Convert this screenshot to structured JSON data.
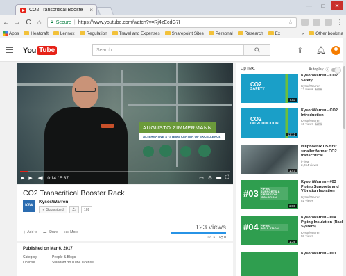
{
  "browser": {
    "tab_title": "CO2 Transcritical Booste",
    "tab_close": "×",
    "address_secure": "Secure",
    "address_url": "https://www.youtube.com/watch?v=Rj4zEcdG7I",
    "window_min": "—",
    "window_max": "□",
    "window_close": "✕"
  },
  "bookmarks": [
    {
      "label": "Apps",
      "type": "apps"
    },
    {
      "label": "Heatcraft",
      "type": "folder"
    },
    {
      "label": "Lennox",
      "type": "folder"
    },
    {
      "label": "Regulation",
      "type": "folder"
    },
    {
      "label": "Travel and Expenses",
      "type": "folder"
    },
    {
      "label": "Sharepoint Sites",
      "type": "folder"
    },
    {
      "label": "Personal",
      "type": "folder"
    },
    {
      "label": "Research",
      "type": "folder"
    },
    {
      "label": "Ex",
      "type": "folder"
    }
  ],
  "bookmarks_more": "»",
  "bookmarks_other": "Other bookma",
  "youtube": {
    "logo_you": "You",
    "logo_tube": "Tube",
    "search_placeholder": "Search"
  },
  "player": {
    "overlay_name": "AUGUSTO ZIMMERMANN",
    "overlay_sub": "ALTERNATIVE SYSTEMS CENTER OF EXCELLENCE",
    "time": "0:14 / 5:37",
    "progress_fraction": 0.04
  },
  "video": {
    "title": "CO2 Transcritical Booster Rack",
    "channel": "Kysor/Warren",
    "channel_logo": "K/W",
    "subscribe": "✓ Subscribed",
    "sub_count": "109",
    "views": "123 views",
    "add_to": "Add to",
    "share": "Share",
    "more": "More",
    "likes": "3",
    "dislikes": "0"
  },
  "description": {
    "published": "Published on Mar 6, 2017",
    "category_key": "Category",
    "category_value": "People & Blogs",
    "license_key": "License",
    "license_value": "Standard YouTube License"
  },
  "sidebar": {
    "up_next": "Up next",
    "autoplay": "Autoplay",
    "items": [
      {
        "title": "Kysor/Warren - CO2 Safety",
        "channel": "Kysor/Warren",
        "views": "13 views",
        "badge": "NEW",
        "thumb_big": "CO2",
        "thumb_small": "SAFETY",
        "duration": "7:53",
        "color": "#1a9fc8",
        "kind": "teal"
      },
      {
        "title": "Kysor/Warren - CO2 Introduction",
        "channel": "Kysor/Warren",
        "views": "10 views",
        "badge": "NEW",
        "thumb_big": "CO2",
        "thumb_small": "INTRODUCTION",
        "duration": "12:12",
        "color": "#1a9fc8",
        "kind": "teal"
      },
      {
        "title": "Hillphoenix US first smaller format CO2 transcritical",
        "channel": "iFriea",
        "views": "2,264 views",
        "badge": "",
        "thumb_big": "",
        "thumb_small": "",
        "duration": "1:47",
        "color": "#5a6a70",
        "kind": "photo"
      },
      {
        "title": "Kysor/Warren - #03 Piping Supports and Vibration Isolation",
        "channel": "Kysor/Warren",
        "views": "81 views",
        "badge": "",
        "thumb_big": "#03",
        "thumb_small": "PIPING SUPPORTS & VIBRATION ISOLATION",
        "duration": "2:00",
        "color": "#2f9e4f",
        "kind": "green"
      },
      {
        "title": "Kysor/Warren - #04 Piping Insulation (Rack System)",
        "channel": "Kysor/Warren",
        "views": "58 views",
        "badge": "",
        "thumb_big": "#04",
        "thumb_small": "PIPING INSULATION",
        "duration": "1:39",
        "color": "#2f9e4f",
        "kind": "green"
      },
      {
        "title": "Kysor/Warren - #01",
        "channel": "",
        "views": "",
        "badge": "",
        "thumb_big": "",
        "thumb_small": "",
        "duration": "",
        "color": "#2f9e4f",
        "kind": "green"
      }
    ]
  }
}
